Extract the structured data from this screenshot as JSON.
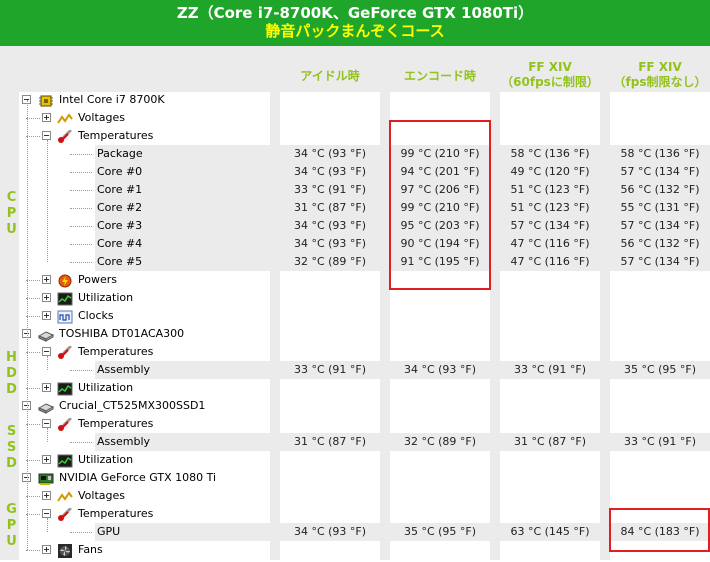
{
  "header": {
    "title": "ZZ（Core i7-8700K、GeForce GTX 1080Ti）",
    "subtitle": "静音パックまんぞくコース"
  },
  "columns": {
    "idle": [
      "アイドル時"
    ],
    "encode": [
      "エンコード時"
    ],
    "ff60": [
      "FF XIV",
      "（60fpsに制限）"
    ],
    "ffnolimit": [
      "FF XIV",
      "（fps制限なし）"
    ]
  },
  "sections": {
    "cpu": "CPU",
    "hdd": "HDD",
    "ssd": "SSD",
    "gpu": "GPU"
  },
  "rows": [
    {
      "label": "Intel Core i7 8700K",
      "level": 0,
      "icon": "cpu-chip-icon",
      "expander": "minus",
      "shade": false,
      "values": [
        "",
        "",
        "",
        ""
      ]
    },
    {
      "label": "Voltages",
      "level": 1,
      "icon": "voltage-icon",
      "expander": "plus",
      "shade": false,
      "values": [
        "",
        "",
        "",
        ""
      ]
    },
    {
      "label": "Temperatures",
      "level": 1,
      "icon": "thermometer-icon",
      "expander": "minus",
      "shade": false,
      "values": [
        "",
        "",
        "",
        ""
      ]
    },
    {
      "label": "Package",
      "level": 2,
      "icon": "",
      "expander": "",
      "shade": true,
      "values": [
        "34 °C  (93 °F)",
        "99 °C  (210 °F)",
        "58 °C  (136 °F)",
        "58 °C  (136 °F)"
      ]
    },
    {
      "label": "Core #0",
      "level": 2,
      "icon": "",
      "expander": "",
      "shade": true,
      "values": [
        "34 °C  (93 °F)",
        "94 °C  (201 °F)",
        "49 °C  (120 °F)",
        "57 °C  (134 °F)"
      ]
    },
    {
      "label": "Core #1",
      "level": 2,
      "icon": "",
      "expander": "",
      "shade": true,
      "values": [
        "33 °C  (91 °F)",
        "97 °C  (206 °F)",
        "51 °C  (123 °F)",
        "56 °C  (132 °F)"
      ]
    },
    {
      "label": "Core #2",
      "level": 2,
      "icon": "",
      "expander": "",
      "shade": true,
      "values": [
        "31 °C  (87 °F)",
        "99 °C  (210 °F)",
        "51 °C  (123 °F)",
        "55 °C  (131 °F)"
      ]
    },
    {
      "label": "Core #3",
      "level": 2,
      "icon": "",
      "expander": "",
      "shade": true,
      "values": [
        "34 °C  (93 °F)",
        "95 °C  (203 °F)",
        "57 °C  (134 °F)",
        "57 °C  (134 °F)"
      ]
    },
    {
      "label": "Core #4",
      "level": 2,
      "icon": "",
      "expander": "",
      "shade": true,
      "values": [
        "34 °C  (93 °F)",
        "90 °C  (194 °F)",
        "47 °C  (116 °F)",
        "56 °C  (132 °F)"
      ]
    },
    {
      "label": "Core #5",
      "level": 2,
      "icon": "",
      "expander": "",
      "shade": true,
      "values": [
        "32 °C  (89 °F)",
        "91 °C  (195 °F)",
        "47 °C  (116 °F)",
        "57 °C  (134 °F)"
      ]
    },
    {
      "label": "Powers",
      "level": 1,
      "icon": "power-icon",
      "expander": "plus",
      "shade": false,
      "values": [
        "",
        "",
        "",
        ""
      ]
    },
    {
      "label": "Utilization",
      "level": 1,
      "icon": "utilization-icon",
      "expander": "plus",
      "shade": false,
      "values": [
        "",
        "",
        "",
        ""
      ]
    },
    {
      "label": "Clocks",
      "level": 1,
      "icon": "clock-icon",
      "expander": "plus",
      "shade": false,
      "values": [
        "",
        "",
        "",
        ""
      ]
    },
    {
      "label": "TOSHIBA DT01ACA300",
      "level": 0,
      "icon": "disk-drive-icon",
      "expander": "minus",
      "shade": false,
      "values": [
        "",
        "",
        "",
        ""
      ]
    },
    {
      "label": "Temperatures",
      "level": 1,
      "icon": "thermometer-icon",
      "expander": "minus",
      "shade": false,
      "values": [
        "",
        "",
        "",
        ""
      ]
    },
    {
      "label": "Assembly",
      "level": 2,
      "icon": "",
      "expander": "",
      "shade": true,
      "values": [
        "33 °C  (91 °F)",
        "34 °C  (93 °F)",
        "33 °C  (91 °F)",
        "35 °C  (95 °F)"
      ]
    },
    {
      "label": "Utilization",
      "level": 1,
      "icon": "utilization-icon",
      "expander": "plus",
      "shade": false,
      "values": [
        "",
        "",
        "",
        ""
      ]
    },
    {
      "label": "Crucial_CT525MX300SSD1",
      "level": 0,
      "icon": "disk-drive-icon",
      "expander": "minus",
      "shade": false,
      "values": [
        "",
        "",
        "",
        ""
      ]
    },
    {
      "label": "Temperatures",
      "level": 1,
      "icon": "thermometer-icon",
      "expander": "minus",
      "shade": false,
      "values": [
        "",
        "",
        "",
        ""
      ]
    },
    {
      "label": "Assembly",
      "level": 2,
      "icon": "",
      "expander": "",
      "shade": true,
      "values": [
        "31 °C  (87 °F)",
        "32 °C  (89 °F)",
        "31 °C  (87 °F)",
        "33 °C  (91 °F)"
      ]
    },
    {
      "label": "Utilization",
      "level": 1,
      "icon": "utilization-icon",
      "expander": "plus",
      "shade": false,
      "values": [
        "",
        "",
        "",
        ""
      ]
    },
    {
      "label": "NVIDIA GeForce GTX 1080 Ti",
      "level": 0,
      "icon": "gpu-card-icon",
      "expander": "minus",
      "shade": false,
      "values": [
        "",
        "",
        "",
        ""
      ]
    },
    {
      "label": "Voltages",
      "level": 1,
      "icon": "voltage-icon",
      "expander": "plus",
      "shade": false,
      "values": [
        "",
        "",
        "",
        ""
      ]
    },
    {
      "label": "Temperatures",
      "level": 1,
      "icon": "thermometer-icon",
      "expander": "minus",
      "shade": false,
      "values": [
        "",
        "",
        "",
        ""
      ]
    },
    {
      "label": "GPU",
      "level": 2,
      "icon": "",
      "expander": "",
      "shade": true,
      "values": [
        "34 °C  (93 °F)",
        "35 °C  (95 °F)",
        "63 °C  (145 °F)",
        "84 °C  (183 °F)"
      ]
    },
    {
      "label": "Fans",
      "level": 1,
      "icon": "fan-icon",
      "expander": "plus",
      "shade": false,
      "values": [
        "",
        "",
        "",
        ""
      ]
    }
  ],
  "colors": {
    "header_bg": "#1ea52a",
    "subtitle": "#ffff00",
    "accent": "#92c21c",
    "highlight": "#e02020"
  }
}
